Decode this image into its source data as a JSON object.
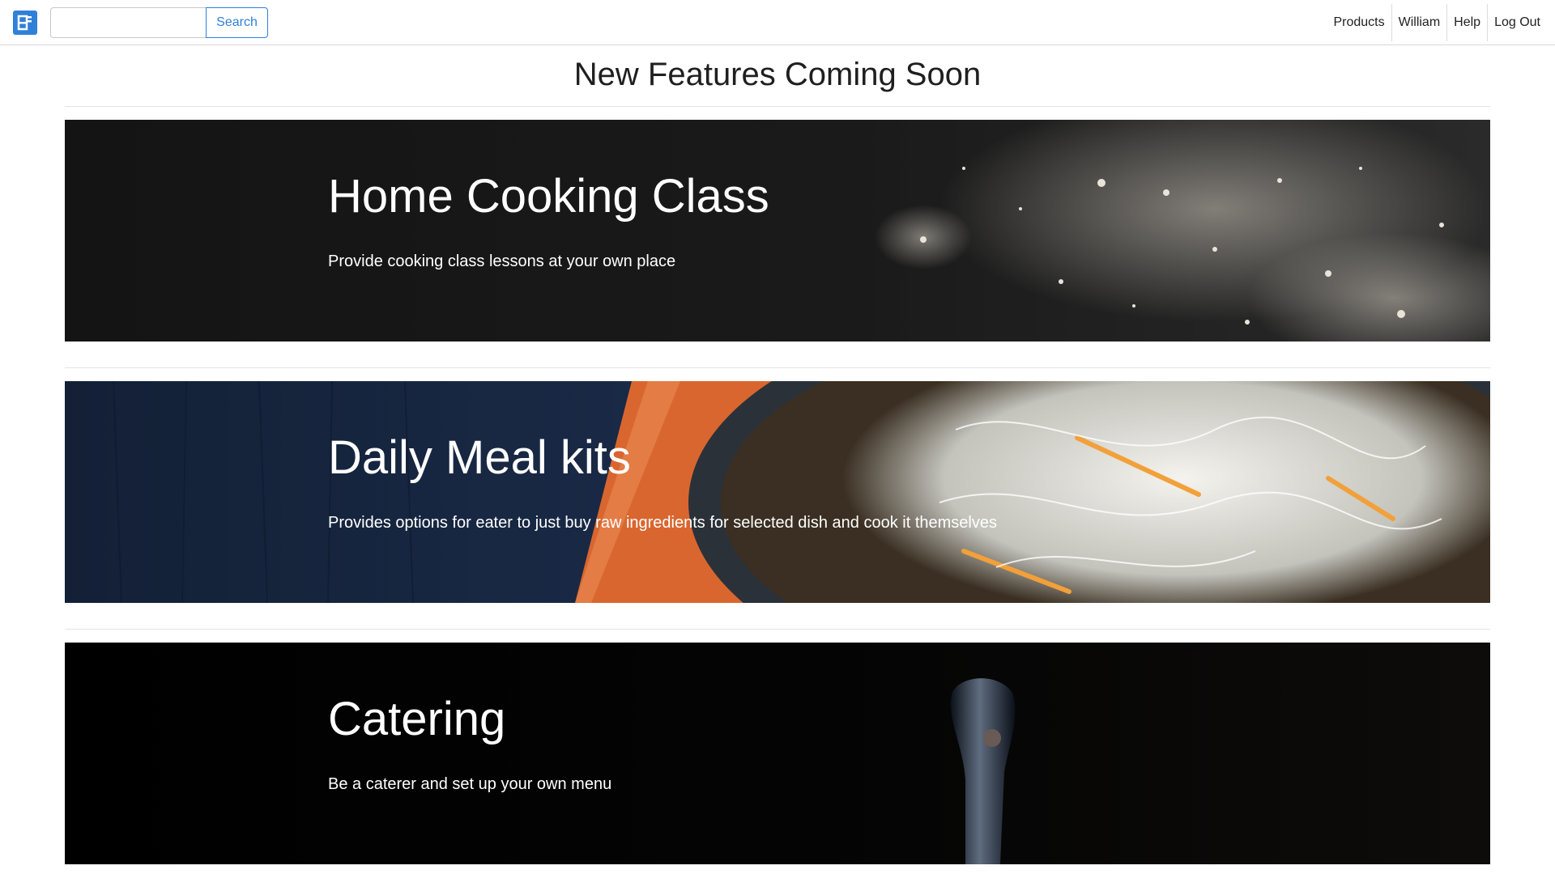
{
  "header": {
    "logo_icon": "app-logo-icon",
    "search": {
      "value": "",
      "placeholder": "",
      "button_label": "Search"
    },
    "nav": [
      {
        "label": "Products"
      },
      {
        "label": "William"
      },
      {
        "label": "Help"
      },
      {
        "label": "Log Out"
      }
    ],
    "accent_color": "#2f80d8"
  },
  "main": {
    "title": "New Features Coming Soon",
    "features": [
      {
        "title": "Home Cooking Class",
        "description": "Provide cooking class lessons at your own place",
        "image_icon": "flour-dusted-table-image"
      },
      {
        "title": "Daily Meal kits",
        "description": "Provides options for eater to just buy raw ingredients for selected dish and cook it themselves",
        "image_icon": "noodle-bowl-image"
      },
      {
        "title": "Catering",
        "description": "Be a caterer and set up your own menu",
        "image_icon": "ladle-image"
      }
    ]
  }
}
